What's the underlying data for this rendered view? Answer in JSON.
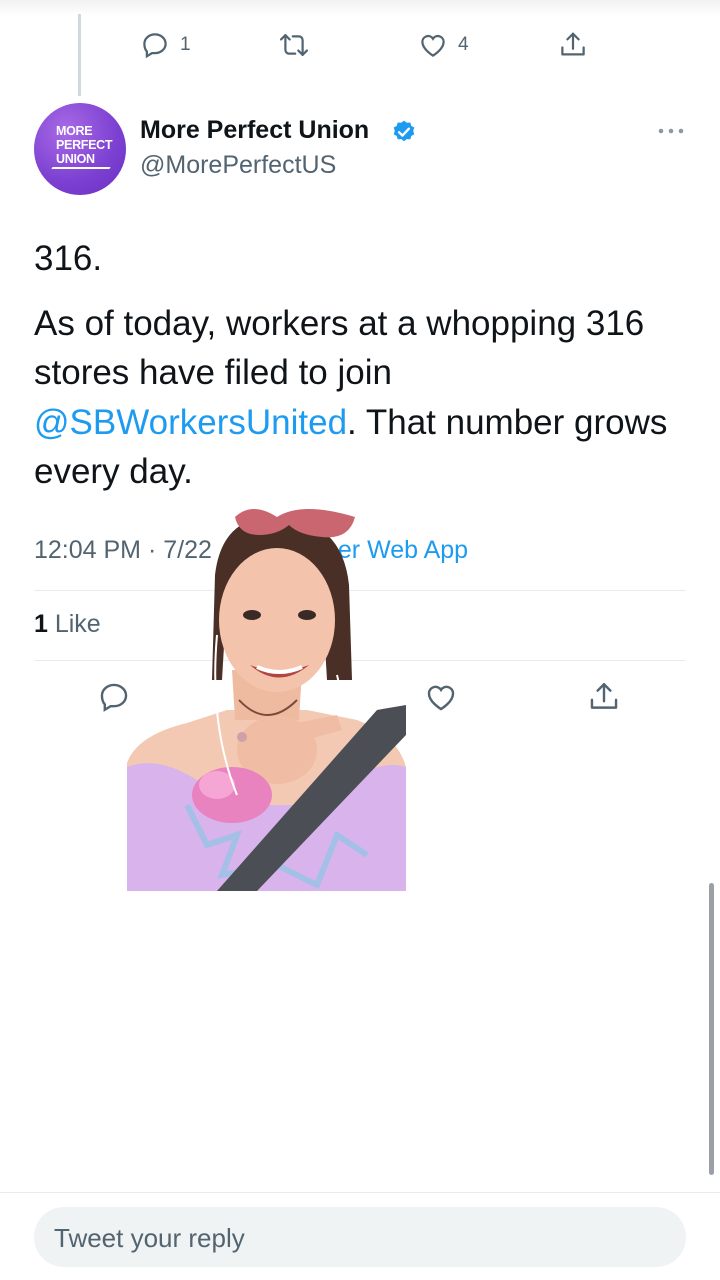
{
  "previous_tweet": {
    "reply_count": "1",
    "like_count": "4"
  },
  "author": {
    "display_name": "More Perfect Union",
    "handle": "@MorePerfectUS",
    "avatar_text": [
      "MORE",
      "PERFECT",
      "UNION"
    ],
    "verified": true
  },
  "tweet": {
    "line1": "316.",
    "body_before": "As of today, workers at a whopping 316 stores have filed to join ",
    "mention": "@SBWorkersUnited",
    "body_after": ". That number grows every day.",
    "timestamp_visible": "12:04 PM · 7/22",
    "source_visible": "er Web App"
  },
  "stats": {
    "like_count": "1",
    "like_label": " Like"
  },
  "reply": {
    "placeholder": "Tweet your reply"
  },
  "colors": {
    "link": "#1d9bf0",
    "secondary_text": "#536471",
    "avatar_purple": "#7b3fd1",
    "verified_blue": "#1d9bf0"
  },
  "icons": [
    "reply-icon",
    "retweet-icon",
    "like-icon",
    "share-icon",
    "verified-icon",
    "more-icon"
  ]
}
